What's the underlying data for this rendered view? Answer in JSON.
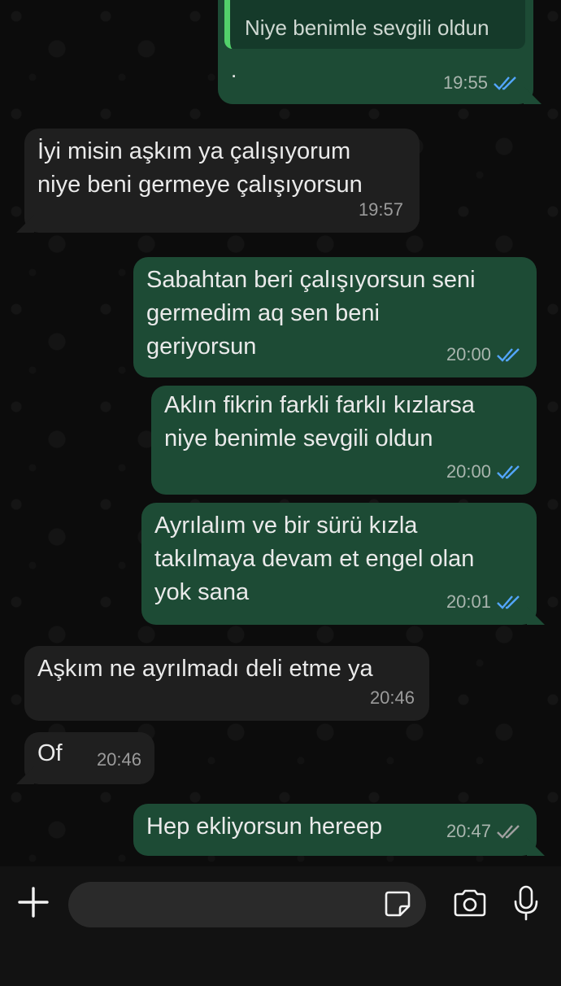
{
  "messages": [
    {
      "id": "m0",
      "direction": "out",
      "quote": "Niye benimle sevgili oldun",
      "text": ".",
      "time": "19:55",
      "status": "read"
    },
    {
      "id": "m1",
      "direction": "in",
      "text": "İyi misin aşkım ya çalışıyorum\nniye beni germeye çalışıyorsun",
      "time": "19:57"
    },
    {
      "id": "m2",
      "direction": "out",
      "text": "Sabahtan beri çalışıyorsun seni\ngermedim aq sen beni\ngeriyorsun",
      "time": "20:00",
      "status": "read"
    },
    {
      "id": "m3",
      "direction": "out",
      "text": "Aklın fikrin farkli farklı kızlarsa\nniye benimle sevgili oldun",
      "time": "20:00",
      "status": "read"
    },
    {
      "id": "m4",
      "direction": "out",
      "text": "Ayrılalım ve bir sürü kızla\ntakılmaya devam et engel olan\nyok sana",
      "time": "20:01",
      "status": "read"
    },
    {
      "id": "m5",
      "direction": "in",
      "text": "Aşkım ne ayrılmadı deli etme ya",
      "time": "20:46"
    },
    {
      "id": "m6",
      "direction": "in",
      "text": "Of",
      "time": "20:46"
    },
    {
      "id": "m7",
      "direction": "out",
      "text": "Hep ekliyorsun hereep",
      "time": "20:47",
      "status": "delivered"
    }
  ],
  "input": {
    "placeholder": ""
  },
  "icons": {
    "plus": "plus-icon",
    "sticker": "sticker-icon",
    "camera": "camera-icon",
    "mic": "microphone-icon",
    "read": "double-check-blue-icon",
    "delivered": "double-check-grey-icon"
  },
  "colors": {
    "outgoing_bubble": "#1d4b35",
    "incoming_bubble": "#1f1f1f",
    "read_ticks": "#53a6ff",
    "delivered_ticks": "#a0a0a0",
    "quote_bar": "#53d16b"
  }
}
